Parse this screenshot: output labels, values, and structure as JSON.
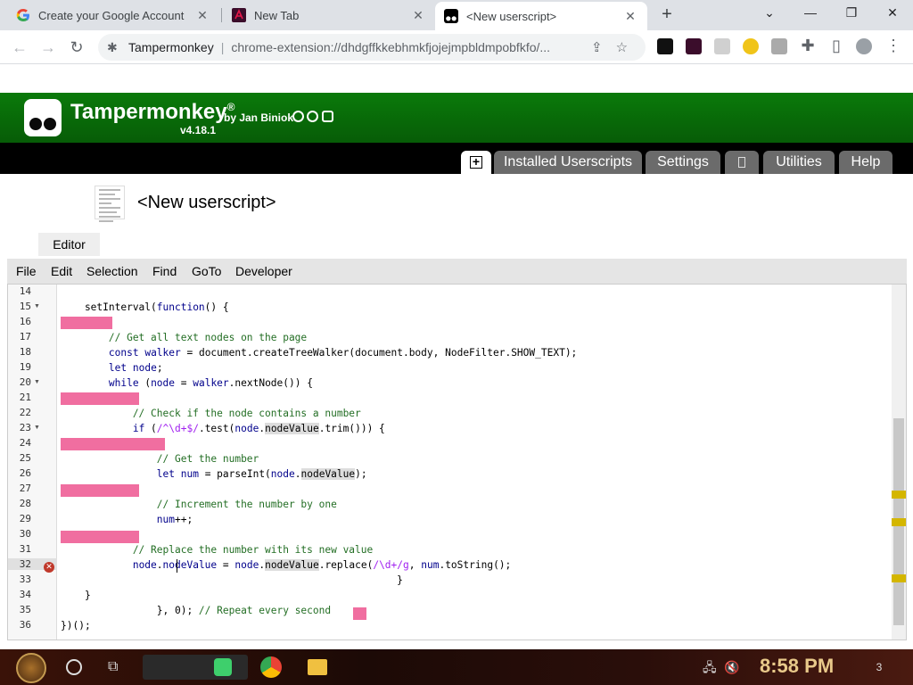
{
  "browser": {
    "tabs": [
      {
        "title": "Create your Google Account",
        "icon": "google-icon"
      },
      {
        "title": "New Tab",
        "icon": "tampermonkey-icon"
      },
      {
        "title": "<New userscript>",
        "icon": "tampermonkey-icon",
        "active": true
      }
    ],
    "omnibox": {
      "site": "Tampermonkey",
      "url": "chrome-extension://dhdgffkkebhmkfjojejmpbldmpobfkfo/..."
    }
  },
  "tm": {
    "brand": "Tampermonkey",
    "registered": "®",
    "by": "by Jan Biniok",
    "version": "v4.18.1",
    "nav_tabs": [
      "Installed Userscripts",
      "Settings",
      "Utilities",
      "Help"
    ],
    "script_title": "<New userscript>",
    "editor_tab": "Editor",
    "menu": [
      "File",
      "Edit",
      "Selection",
      "Find",
      "GoTo",
      "Developer"
    ]
  },
  "editor": {
    "line_numbers": [
      "14",
      "15",
      "16",
      "17",
      "18",
      "19",
      "20",
      "21",
      "22",
      "23",
      "24",
      "25",
      "26",
      "27",
      "28",
      "29",
      "30",
      "31",
      "32",
      "33",
      "34",
      "35",
      "36"
    ],
    "current_line": "32"
  },
  "taskbar": {
    "clock": "8:58 PM",
    "notification_count": "3"
  },
  "colors": {
    "tm_green": "#0a7a0a",
    "whitespace_marker": "#f06ea0",
    "error": "#c0392b"
  }
}
